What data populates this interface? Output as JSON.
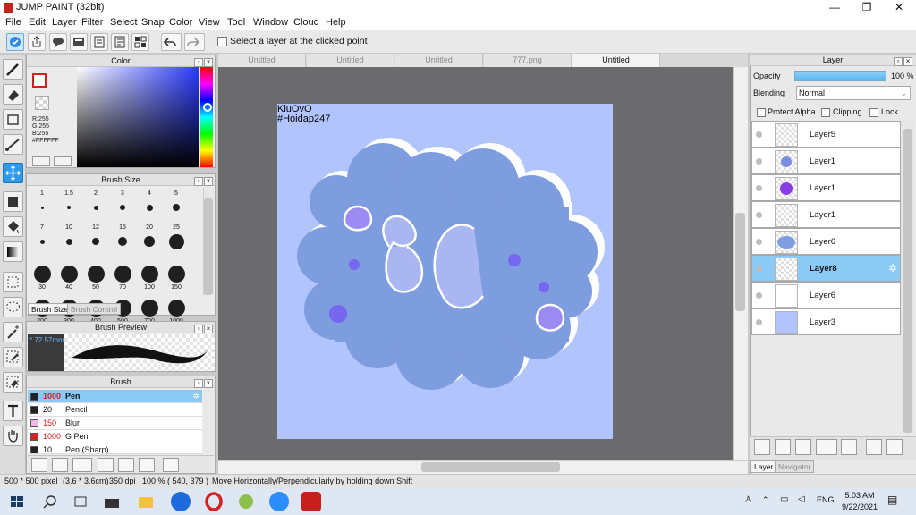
{
  "window": {
    "title": "JUMP PAINT (32bit)",
    "minimize": "—",
    "maximize": "❐",
    "close": "✕"
  },
  "menu": [
    "File",
    "Edit",
    "Layer",
    "Filter",
    "Select",
    "Snap",
    "Color",
    "View",
    "Tool",
    "Window",
    "Cloud",
    "Help"
  ],
  "toolbar": {
    "layer_select_label": "Select a layer at the clicked point"
  },
  "color_panel": {
    "title": "Color",
    "r": "R:255",
    "g": "G:255",
    "b": "B:255",
    "hex": "#FFFFFF"
  },
  "brush_size_panel": {
    "title": "Brush Size",
    "sizes": [
      "1",
      "1.5",
      "2",
      "3",
      "4",
      "5",
      "7",
      "10",
      "12",
      "15",
      "20",
      "25",
      "30",
      "40",
      "50",
      "70",
      "100",
      "150",
      "200",
      "300",
      "400",
      "500",
      "700",
      "1000"
    ],
    "tab_active": "Brush Size",
    "tab_inactive": "Brush Control"
  },
  "brush_preview": {
    "title": "Brush Preview",
    "size": "* 72.57mm"
  },
  "brush_panel": {
    "title": "Brush",
    "items": [
      {
        "size": "1000",
        "name": "Pen",
        "color": "#222222",
        "selected": true
      },
      {
        "size": "20",
        "name": "Pencil",
        "color": "#222222",
        "selected": false
      },
      {
        "size": "150",
        "name": "Blur",
        "color": "#f2b6e8",
        "selected": false
      },
      {
        "size": "1000",
        "name": "G Pen",
        "color": "#e02020",
        "selected": false
      },
      {
        "size": "10",
        "name": "Pen (Sharp)",
        "color": "#222222",
        "selected": false
      }
    ]
  },
  "doc_tabs": [
    "Untitled",
    "Untitled",
    "Untitled",
    "777.png",
    "Untitled"
  ],
  "canvas": {
    "watermark_line1": "KiuOvO",
    "watermark_line2": "#Hoidap247"
  },
  "layer_panel": {
    "title": "Layer",
    "opacity_label": "Opacity",
    "opacity_value": "100 %",
    "blending_label": "Blending",
    "blending_value": "Normal",
    "protect_alpha": "Protect Alpha",
    "clipping": "Clipping",
    "lock": "Lock",
    "layers": [
      {
        "name": "Layer5",
        "selected": false
      },
      {
        "name": "Layer1",
        "selected": false
      },
      {
        "name": "Layer1",
        "selected": false
      },
      {
        "name": "Layer1",
        "selected": false
      },
      {
        "name": "Layer6",
        "selected": false
      },
      {
        "name": "Layer8",
        "selected": true
      },
      {
        "name": "Layer6",
        "selected": false
      },
      {
        "name": "Layer3",
        "selected": false
      }
    ],
    "tab_active": "Layer",
    "tab_inactive": "Navigator"
  },
  "statusbar": {
    "size": "500 * 500 pixel",
    "physical": "(3.6 * 3.6cm)",
    "dpi": "350 dpi",
    "zoom": "100 %",
    "coords": "( 540, 379 )",
    "hint": "Move Horizontally/Perpendicularly by holding down Shift"
  },
  "taskbar": {
    "time": "5:03 AM",
    "date": "9/22/2021",
    "lang": "ENG"
  },
  "colors": {
    "accent": "#2f9ae8",
    "canvas_bg": "#b1c4fc",
    "selection": "#8ccaf6"
  }
}
